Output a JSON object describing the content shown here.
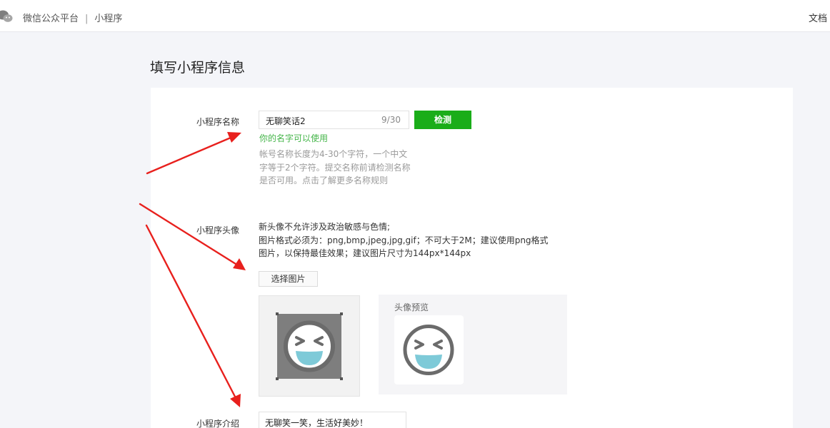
{
  "header": {
    "platform": "微信公众平台",
    "separator": "|",
    "section": "小程序",
    "doc_link": "文档"
  },
  "page": {
    "title": "填写小程序信息"
  },
  "form": {
    "name": {
      "label": "小程序名称",
      "value": "无聊笑话2",
      "counter": "9/30",
      "check_button": "检测",
      "success_message": "你的名字可以使用",
      "hint": "帐号名称长度为4-30个字符，一个中文字等于2个字符。提交名称前请检测名称是否可用。点击了解更多名称规则"
    },
    "avatar": {
      "label": "小程序头像",
      "desc_line1": "新头像不允许涉及政治敏感与色情;",
      "desc_line2": "图片格式必须为：png,bmp,jpeg,jpg,gif；不可大于2M；建议使用png格式",
      "desc_line3": "图片，以保持最佳效果；建议图片尺寸为144px*144px",
      "choose_button": "选择图片",
      "preview_label": "头像预览"
    },
    "intro": {
      "label": "小程序介绍",
      "value": "无聊笑一笑，生活好美妙！"
    }
  },
  "colors": {
    "accent_green": "#1aad19",
    "success_green": "#44b549",
    "annotation_red": "#e8201d",
    "emoji_mouth": "#7ecad8",
    "emoji_stroke": "#6b6b6b"
  },
  "icons": {
    "logo": "wechat-logo-icon",
    "avatar": "laughing-face-icon"
  }
}
